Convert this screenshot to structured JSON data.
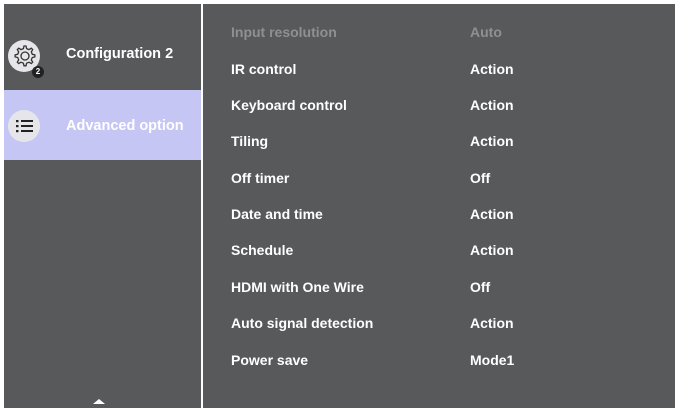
{
  "sidebar": {
    "items": [
      {
        "label": "Configuration 2",
        "icon": "gear-icon",
        "badge": "2"
      },
      {
        "label": "Advanced option",
        "icon": "list-icon"
      }
    ]
  },
  "settings": [
    {
      "name": "Input resolution",
      "value": "Auto"
    },
    {
      "name": "IR control",
      "value": "Action"
    },
    {
      "name": "Keyboard control",
      "value": "Action"
    },
    {
      "name": "Tiling",
      "value": "Action"
    },
    {
      "name": "Off timer",
      "value": "Off"
    },
    {
      "name": "Date and time",
      "value": "Action"
    },
    {
      "name": "Schedule",
      "value": "Action"
    },
    {
      "name": "HDMI with One Wire",
      "value": "Off"
    },
    {
      "name": "Auto signal detection",
      "value": "Action"
    },
    {
      "name": "Power save",
      "value": "Mode1"
    }
  ],
  "colors": {
    "panel": "#58595b",
    "selected": "#c5c6f4",
    "text": "#ffffff",
    "disabled_text": "#8f9094"
  }
}
